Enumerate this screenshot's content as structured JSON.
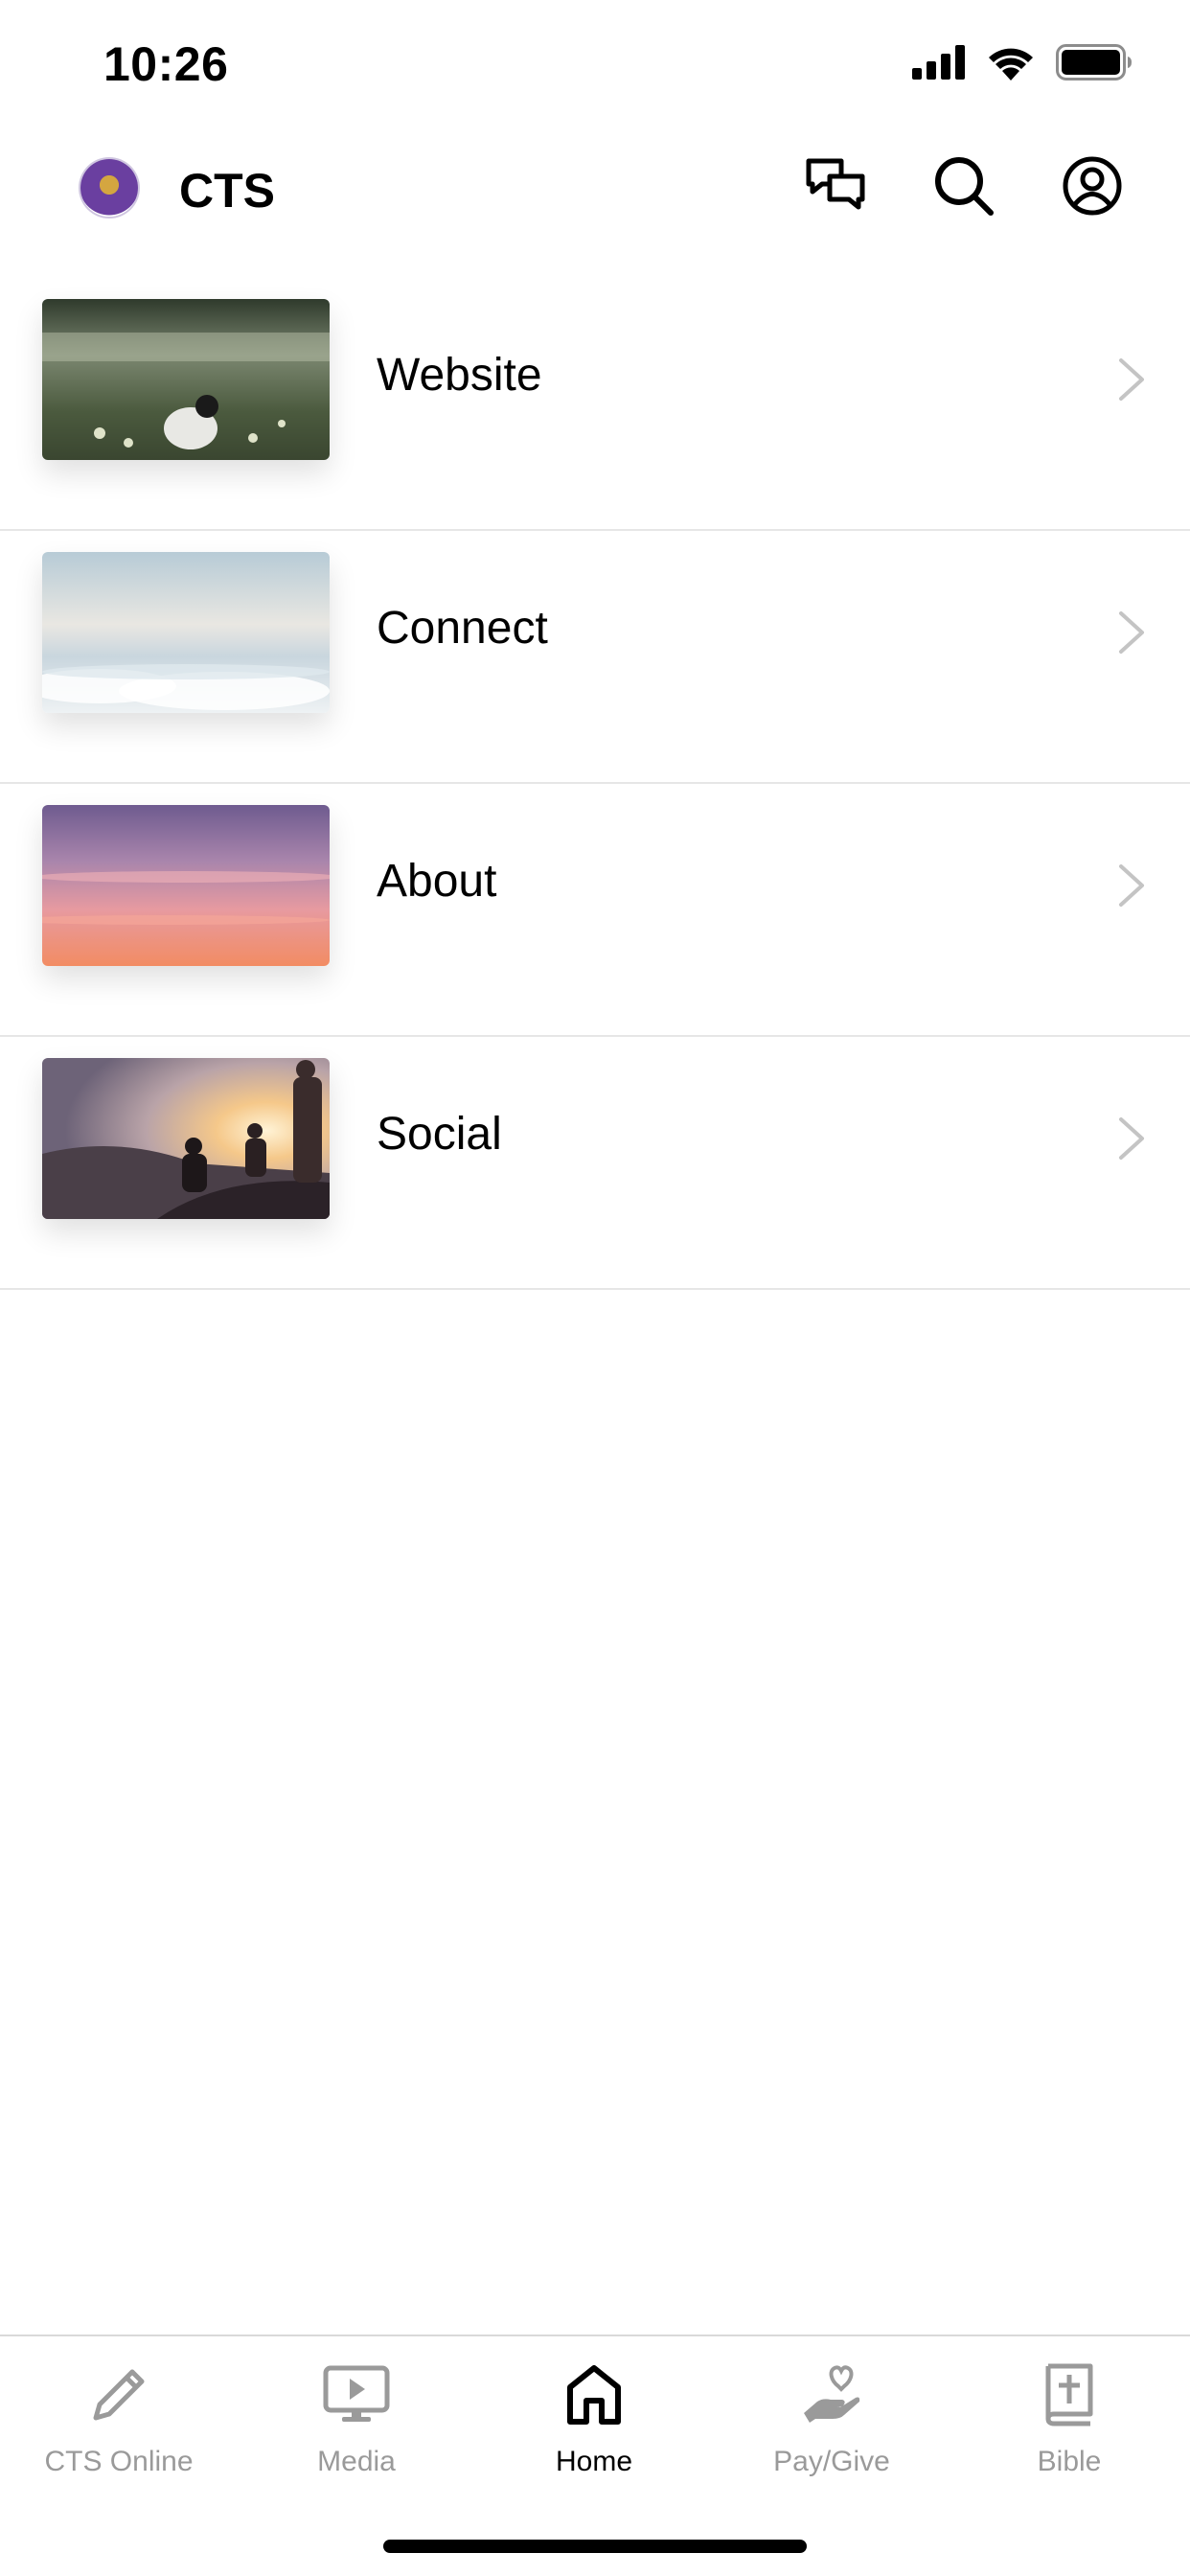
{
  "status_bar": {
    "time": "10:26",
    "icons": [
      "signal-icon",
      "wifi-icon",
      "battery-icon"
    ]
  },
  "header": {
    "title": "CTS",
    "logo": "church-seal-logo",
    "actions": [
      "chat-icon",
      "search-icon",
      "profile-icon"
    ]
  },
  "menu": {
    "items": [
      {
        "label": "Website",
        "thumbnail": "field-with-dog-photo"
      },
      {
        "label": "Connect",
        "thumbnail": "clouds-sky-photo"
      },
      {
        "label": "About",
        "thumbnail": "pink-sunset-sky-photo"
      },
      {
        "label": "Social",
        "thumbnail": "people-at-sunset-photo"
      }
    ]
  },
  "tab_bar": {
    "tabs": [
      {
        "label": "CTS Online",
        "icon": "pencil-icon",
        "active": false
      },
      {
        "label": "Media",
        "icon": "play-screen-icon",
        "active": false
      },
      {
        "label": "Home",
        "icon": "home-icon",
        "active": true
      },
      {
        "label": "Pay/Give",
        "icon": "give-hand-heart-icon",
        "active": false
      },
      {
        "label": "Bible",
        "icon": "bible-icon",
        "active": false
      }
    ],
    "inactive_color": "#9a9a9a",
    "active_color": "#000000"
  }
}
